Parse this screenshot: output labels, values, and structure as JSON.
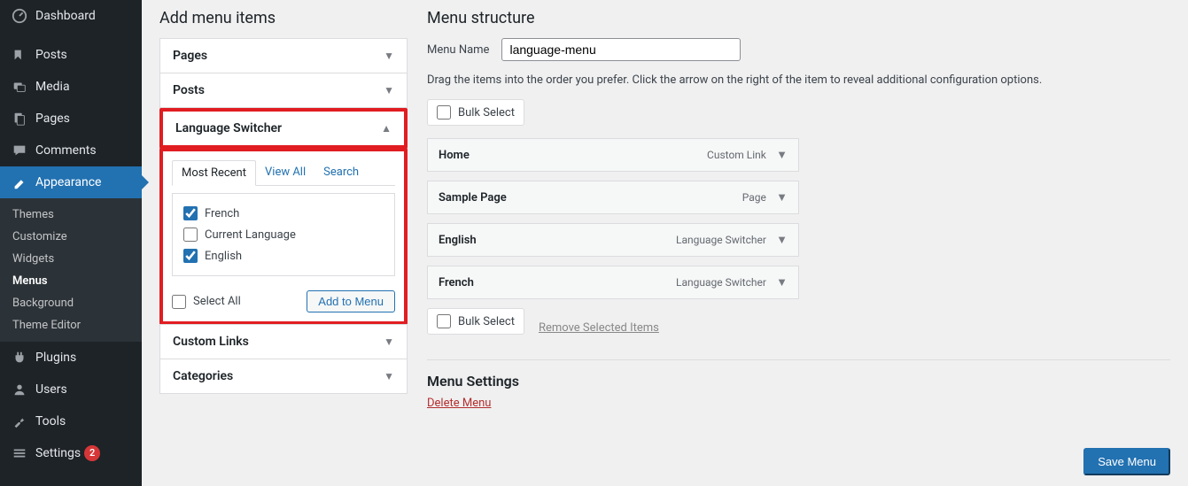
{
  "sidebar": {
    "items": [
      {
        "label": "Dashboard",
        "icon": "dashboard"
      },
      {
        "label": "Posts",
        "icon": "pin"
      },
      {
        "label": "Media",
        "icon": "media"
      },
      {
        "label": "Pages",
        "icon": "pages"
      },
      {
        "label": "Comments",
        "icon": "comments"
      },
      {
        "label": "Appearance",
        "icon": "appearance"
      },
      {
        "label": "Plugins",
        "icon": "plugins"
      },
      {
        "label": "Users",
        "icon": "users"
      },
      {
        "label": "Tools",
        "icon": "tools"
      },
      {
        "label": "Settings",
        "icon": "settings",
        "badge": "2"
      }
    ],
    "appearance_sub": [
      "Themes",
      "Customize",
      "Widgets",
      "Menus",
      "Background",
      "Theme Editor"
    ]
  },
  "left": {
    "heading": "Add menu items",
    "boxes": {
      "pages": "Pages",
      "posts": "Posts",
      "lang": "Language Switcher",
      "custom": "Custom Links",
      "categories": "Categories"
    },
    "tabs": {
      "recent": "Most Recent",
      "viewall": "View All",
      "search": "Search"
    },
    "langs": {
      "french": "French",
      "current": "Current Language",
      "english": "English"
    },
    "checked": {
      "french": true,
      "current": false,
      "english": true
    },
    "select_all": "Select All",
    "add_btn": "Add to Menu"
  },
  "right": {
    "heading": "Menu structure",
    "name_label": "Menu Name",
    "name_value": "language-menu",
    "desc": "Drag the items into the order you prefer. Click the arrow on the right of the item to reveal additional configuration options.",
    "bulk": "Bulk Select",
    "remove": "Remove Selected Items",
    "items": [
      {
        "title": "Home",
        "type": "Custom Link"
      },
      {
        "title": "Sample Page",
        "type": "Page"
      },
      {
        "title": "English",
        "type": "Language Switcher"
      },
      {
        "title": "French",
        "type": "Language Switcher"
      }
    ],
    "settings_title": "Menu Settings",
    "delete": "Delete Menu",
    "save": "Save Menu"
  }
}
